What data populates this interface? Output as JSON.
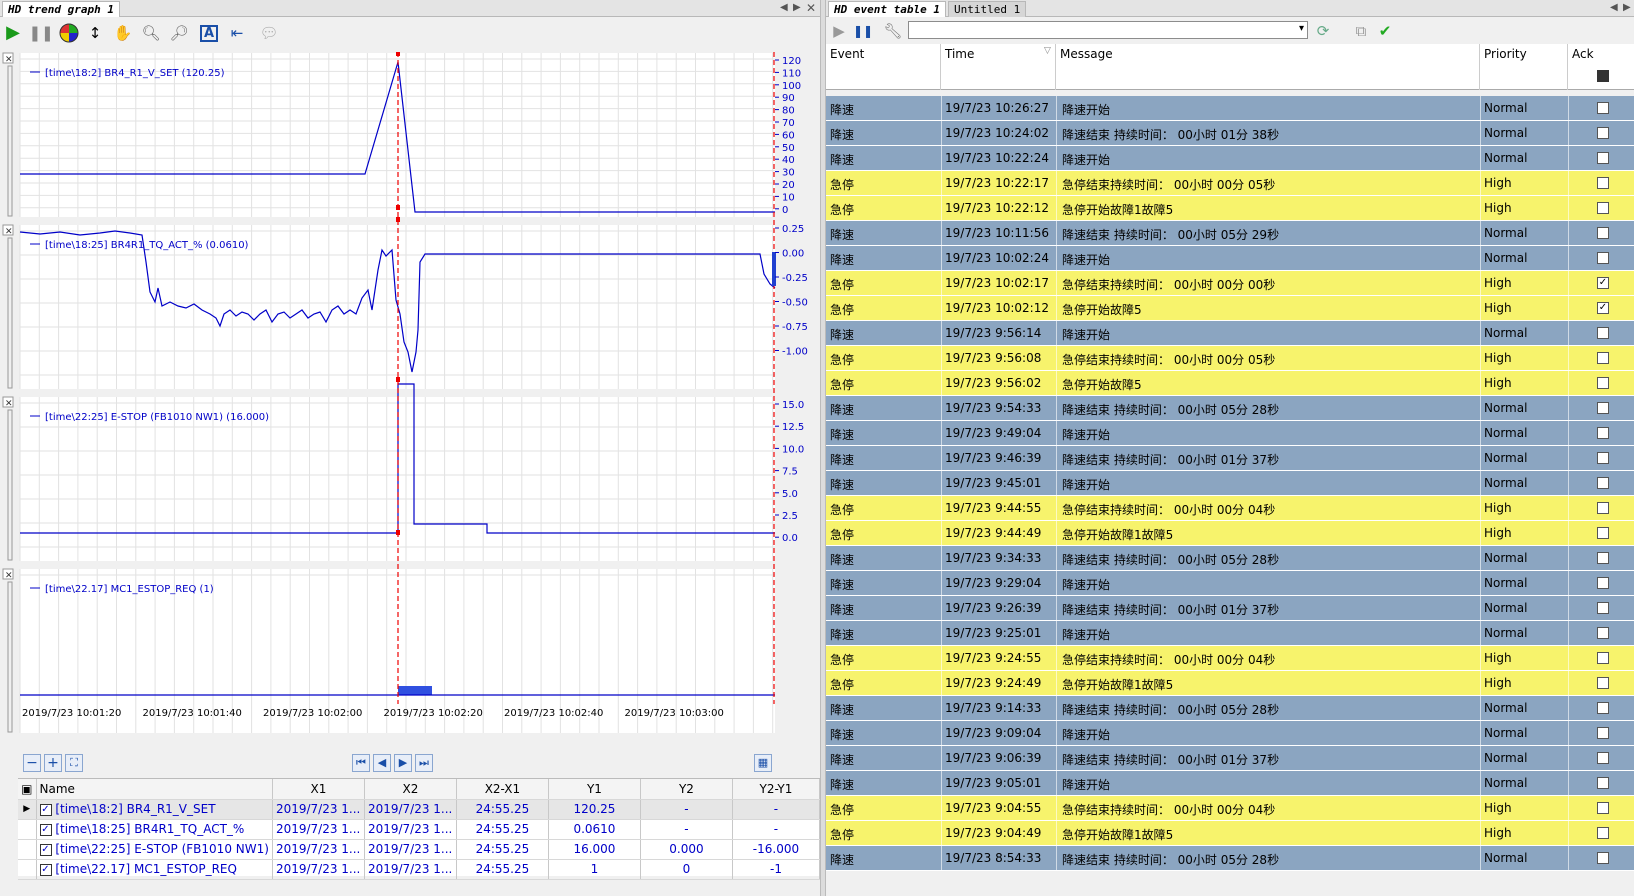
{
  "trend": {
    "tab": "HD trend graph 1",
    "panes": [
      {
        "legend": "[time\\18:2] BR4_R1_V_SET (120.25)",
        "ticks": [
          "120",
          "110",
          "100",
          "90",
          "80",
          "70",
          "60",
          "50",
          "40",
          "30",
          "20",
          "10",
          "0"
        ]
      },
      {
        "legend": "[time\\18:25] BR4R1_TQ_ACT_% (0.0610)",
        "ticks": [
          "0.25",
          "0.00",
          "-0.25",
          "-0.50",
          "-0.75",
          "-1.00"
        ]
      },
      {
        "legend": "[time\\22:25] E-STOP (FB1010 NW1) (16.000)",
        "ticks": [
          "15.0",
          "12.5",
          "10.0",
          "7.5",
          "5.0",
          "2.5",
          "0.0"
        ]
      },
      {
        "legend": "[time\\22.17] MC1_ESTOP_REQ (1)",
        "ticks": []
      }
    ],
    "time_labels": [
      "2019/7/23 10:01:20",
      "2019/7/23 10:01:40",
      "2019/7/23 10:02:00",
      "2019/7/23 10:02:20",
      "2019/7/23 10:02:40",
      "2019/7/23 10:03:00"
    ],
    "table": {
      "headers": [
        "Name",
        "X1",
        "X2",
        "X2-X1",
        "Y1",
        "Y2",
        "Y2-Y1"
      ],
      "rows": [
        {
          "name": "[time\\18:2] BR4_R1_V_SET",
          "x1": "2019/7/23 1...",
          "x2": "2019/7/23 1...",
          "dx": "24:55.25",
          "y1": "120.25",
          "y2": "-",
          "dy": "-"
        },
        {
          "name": "[time\\18:25] BR4R1_TQ_ACT_%",
          "x1": "2019/7/23 1...",
          "x2": "2019/7/23 1...",
          "dx": "24:55.25",
          "y1": "0.0610",
          "y2": "-",
          "dy": "-"
        },
        {
          "name": "[time\\22:25] E-STOP (FB1010 NW1)",
          "x1": "2019/7/23 1...",
          "x2": "2019/7/23 1...",
          "dx": "24:55.25",
          "y1": "16.000",
          "y2": "0.000",
          "dy": "-16.000"
        },
        {
          "name": "[time\\22.17] MC1_ESTOP_REQ",
          "x1": "2019/7/23 1...",
          "x2": "2019/7/23 1...",
          "dx": "24:55.25",
          "y1": "1",
          "y2": "0",
          "dy": "-1"
        }
      ]
    }
  },
  "events": {
    "tabs": [
      "HD event table 1",
      "Untitled 1"
    ],
    "headers": {
      "event": "Event",
      "time": "Time",
      "message": "Message",
      "priority": "Priority",
      "ack": "Ack"
    },
    "rows": [
      {
        "event": "降速",
        "time": "19/7/23 10:26:27",
        "message": "降速开始",
        "priority": "Normal",
        "ack": false
      },
      {
        "event": "降速",
        "time": "19/7/23 10:24:02",
        "message": "降速结束 持续时间： 00小时 01分 38秒",
        "priority": "Normal",
        "ack": false
      },
      {
        "event": "降速",
        "time": "19/7/23 10:22:24",
        "message": "降速开始",
        "priority": "Normal",
        "ack": false
      },
      {
        "event": "急停",
        "time": "19/7/23 10:22:17",
        "message": "急停结束持续时间： 00小时 00分 05秒",
        "priority": "High",
        "ack": false
      },
      {
        "event": "急停",
        "time": "19/7/23 10:22:12",
        "message": "急停开始故障1故障5",
        "priority": "High",
        "ack": false
      },
      {
        "event": "降速",
        "time": "19/7/23 10:11:56",
        "message": "降速结束 持续时间： 00小时 05分 29秒",
        "priority": "Normal",
        "ack": false
      },
      {
        "event": "降速",
        "time": "19/7/23 10:02:24",
        "message": "降速开始",
        "priority": "Normal",
        "ack": false
      },
      {
        "event": "急停",
        "time": "19/7/23 10:02:17",
        "message": "急停结束持续时间： 00小时 00分 00秒",
        "priority": "High",
        "ack": true
      },
      {
        "event": "急停",
        "time": "19/7/23 10:02:12",
        "message": "急停开始故障5",
        "priority": "High",
        "ack": true
      },
      {
        "event": "降速",
        "time": "19/7/23 9:56:14",
        "message": "降速开始",
        "priority": "Normal",
        "ack": false
      },
      {
        "event": "急停",
        "time": "19/7/23 9:56:08",
        "message": "急停结束持续时间： 00小时 00分 05秒",
        "priority": "High",
        "ack": false
      },
      {
        "event": "急停",
        "time": "19/7/23 9:56:02",
        "message": "急停开始故障5",
        "priority": "High",
        "ack": false
      },
      {
        "event": "降速",
        "time": "19/7/23 9:54:33",
        "message": "降速结束 持续时间： 00小时 05分 28秒",
        "priority": "Normal",
        "ack": false
      },
      {
        "event": "降速",
        "time": "19/7/23 9:49:04",
        "message": "降速开始",
        "priority": "Normal",
        "ack": false
      },
      {
        "event": "降速",
        "time": "19/7/23 9:46:39",
        "message": "降速结束 持续时间： 00小时 01分 37秒",
        "priority": "Normal",
        "ack": false
      },
      {
        "event": "降速",
        "time": "19/7/23 9:45:01",
        "message": "降速开始",
        "priority": "Normal",
        "ack": false
      },
      {
        "event": "急停",
        "time": "19/7/23 9:44:55",
        "message": "急停结束持续时间： 00小时 00分 04秒",
        "priority": "High",
        "ack": false
      },
      {
        "event": "急停",
        "time": "19/7/23 9:44:49",
        "message": "急停开始故障1故障5",
        "priority": "High",
        "ack": false
      },
      {
        "event": "降速",
        "time": "19/7/23 9:34:33",
        "message": "降速结束 持续时间： 00小时 05分 28秒",
        "priority": "Normal",
        "ack": false
      },
      {
        "event": "降速",
        "time": "19/7/23 9:29:04",
        "message": "降速开始",
        "priority": "Normal",
        "ack": false
      },
      {
        "event": "降速",
        "time": "19/7/23 9:26:39",
        "message": "降速结束 持续时间： 00小时 01分 37秒",
        "priority": "Normal",
        "ack": false
      },
      {
        "event": "降速",
        "time": "19/7/23 9:25:01",
        "message": "降速开始",
        "priority": "Normal",
        "ack": false
      },
      {
        "event": "急停",
        "time": "19/7/23 9:24:55",
        "message": "急停结束持续时间： 00小时 00分 04秒",
        "priority": "High",
        "ack": false
      },
      {
        "event": "急停",
        "time": "19/7/23 9:24:49",
        "message": "急停开始故障1故障5",
        "priority": "High",
        "ack": false
      },
      {
        "event": "降速",
        "time": "19/7/23 9:14:33",
        "message": "降速结束 持续时间： 00小时 05分 28秒",
        "priority": "Normal",
        "ack": false
      },
      {
        "event": "降速",
        "time": "19/7/23 9:09:04",
        "message": "降速开始",
        "priority": "Normal",
        "ack": false
      },
      {
        "event": "降速",
        "time": "19/7/23 9:06:39",
        "message": "降速结束 持续时间： 00小时 01分 37秒",
        "priority": "Normal",
        "ack": false
      },
      {
        "event": "降速",
        "time": "19/7/23 9:05:01",
        "message": "降速开始",
        "priority": "Normal",
        "ack": false
      },
      {
        "event": "急停",
        "time": "19/7/23 9:04:55",
        "message": "急停结束持续时间： 00小时 00分 04秒",
        "priority": "High",
        "ack": false
      },
      {
        "event": "急停",
        "time": "19/7/23 9:04:49",
        "message": "急停开始故障1故障5",
        "priority": "High",
        "ack": false
      },
      {
        "event": "降速",
        "time": "19/7/23 8:54:33",
        "message": "降速结束 持续时间： 00小时 05分 28秒",
        "priority": "Normal",
        "ack": false
      }
    ]
  }
}
